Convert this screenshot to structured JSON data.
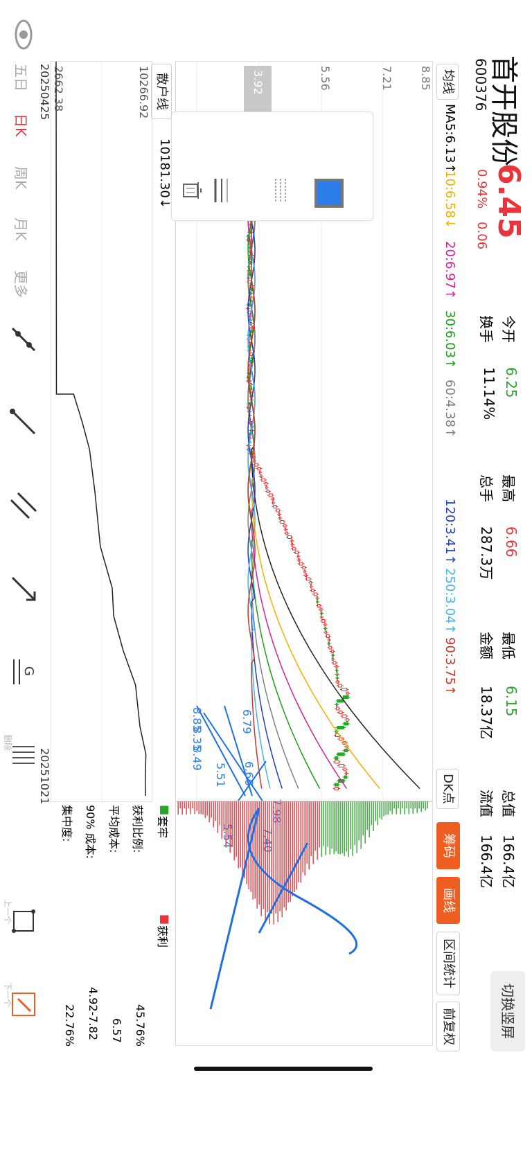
{
  "stock": {
    "name": "首开股份",
    "code": "600376",
    "price": "6.45",
    "change_pct": "0.94%",
    "change": "0.06",
    "open_label": "今开",
    "open": "6.25",
    "high_label": "最高",
    "high": "6.66",
    "low_label": "最低",
    "low": "6.15",
    "total_value_label": "总值",
    "total_value": "166.4亿",
    "turnover_label": "换手",
    "turnover": "11.14%",
    "volume_label": "总手",
    "volume": "287.3万",
    "amount_label": "金额",
    "amount": "18.37亿",
    "float_value_label": "流值",
    "float_value": "166.4亿"
  },
  "header": {
    "switch_screen": "切换竖屏"
  },
  "ma_bar": {
    "selector": "均线",
    "items": [
      {
        "label": "MA5:6.13↑",
        "color": "#222222"
      },
      {
        "label": "10:6.58↓",
        "color": "#f0b000"
      },
      {
        "label": "20:6.97↑",
        "color": "#d0209a"
      },
      {
        "label": "30:6.03↑",
        "color": "#1a9e1a"
      },
      {
        "label": "60:4.38↑",
        "color": "#808080"
      },
      {
        "label": "120:3.41↑",
        "color": "#1f3fbf"
      },
      {
        "label": "250:3.04↑",
        "color": "#4ab0ee"
      },
      {
        "label": "90:3.75↑",
        "color": "#c0392b"
      }
    ],
    "dk_label": "DK点"
  },
  "right_tabs": {
    "chips": "筹码",
    "draw": "画线",
    "range_stats": "区间统计",
    "adjust": "前复权"
  },
  "price_axis": [
    "8.85",
    "7.21",
    "5.56",
    "3.92"
  ],
  "draw_toolbar": {
    "icons": [
      "color-swatch-icon",
      "dashed-line-style-icon",
      "line-width-icon",
      "trash-icon"
    ]
  },
  "annotations": [
    "8.85",
    "8.35",
    "8.49",
    "6.79",
    "6.66",
    "7.98",
    "7.40",
    "5.51",
    "5.54"
  ],
  "chips_panel": {
    "legend_trapped": "套牢",
    "legend_profit": "获利",
    "rows": [
      {
        "label": "获利比例:",
        "value": "45.76%"
      },
      {
        "label": "平均成本:",
        "value": "6.57"
      },
      {
        "label": "90% 成本:",
        "value": "4.92-7.82"
      },
      {
        "label": "集中度:",
        "value": "22.76%"
      }
    ]
  },
  "retail_panel": {
    "selector": "散户线",
    "current": "10181.30↓",
    "max": "10266.92",
    "min": "2662.38",
    "date_start": "20250425",
    "date_end": "20251021"
  },
  "bottom_toolbar": {
    "eye": "分",
    "periods": [
      "五日",
      "日K",
      "周K",
      "月K",
      "更多"
    ],
    "delete_label": "删除",
    "prev": "上一个",
    "next": "下一个"
  },
  "colors": {
    "up": "#e8343b",
    "down": "#2aa52a",
    "accent": "#ee5e21",
    "draw": "#1f6fe0"
  }
}
